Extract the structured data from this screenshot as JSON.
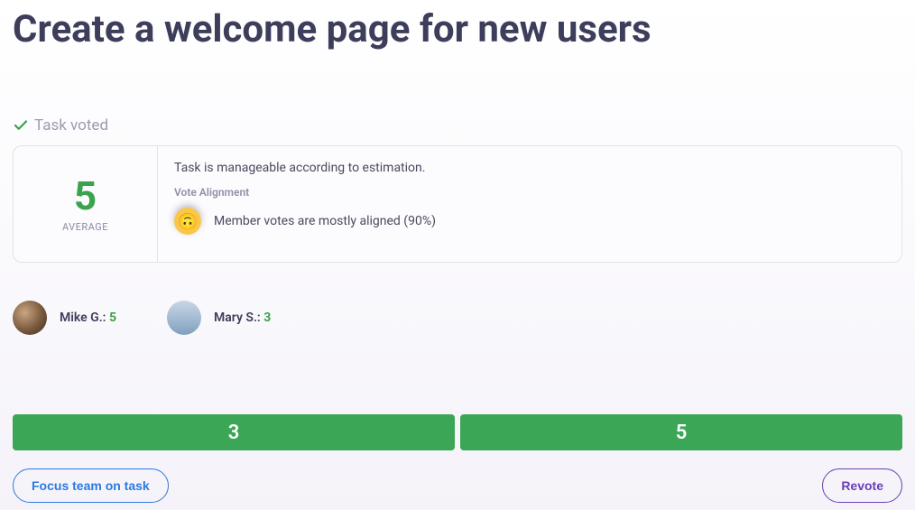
{
  "title": "Create a welcome page for new users",
  "status": {
    "label": "Task voted"
  },
  "summary": {
    "average_value": "5",
    "average_label": "AVERAGE",
    "estimation_text": "Task is manageable according to estimation.",
    "vote_alignment_label": "Vote Alignment",
    "alignment_emoji": "🙂",
    "alignment_text": "Member votes are mostly aligned (90%)"
  },
  "members": [
    {
      "name": "Mike G.:",
      "vote": "5"
    },
    {
      "name": "Mary S.:",
      "vote": "3"
    }
  ],
  "vote_options": [
    "3",
    "5"
  ],
  "actions": {
    "focus": "Focus team on task",
    "revote": "Revote"
  },
  "colors": {
    "accent_green": "#3aa34b",
    "bar_green": "#3ba656",
    "blue": "#2c7ae0",
    "purple": "#6a3fb5"
  }
}
